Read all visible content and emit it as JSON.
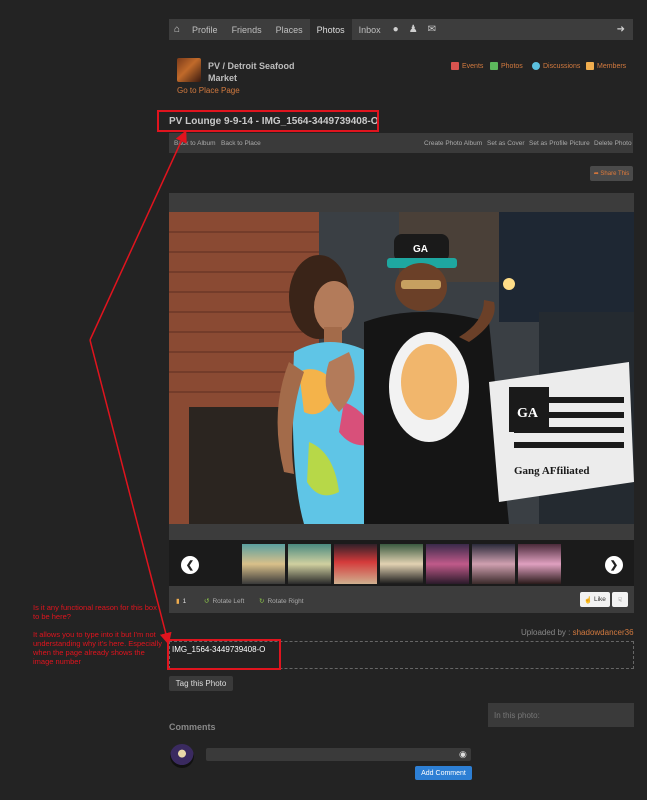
{
  "nav": {
    "items": [
      "Profile",
      "Friends",
      "Places",
      "Photos",
      "Inbox"
    ],
    "active": "Photos"
  },
  "place": {
    "name": "PV / Detroit Seafood Market",
    "goto_link": "Go to Place Page",
    "links": [
      {
        "label": "Events",
        "icon": "calendar-icon",
        "color": "#d9534f"
      },
      {
        "label": "Photos",
        "icon": "photo-icon",
        "color": "#5cb85c"
      },
      {
        "label": "Discussions",
        "icon": "chat-icon",
        "color": "#5bc0de"
      },
      {
        "label": "Members",
        "icon": "members-icon",
        "color": "#f0ad4e"
      }
    ]
  },
  "album": {
    "title": "PV Lounge 9-9-14 - IMG_1564-3449739408-O"
  },
  "toolbar": {
    "back_to_album": "Back to Album",
    "back_to_place": "Back to Place",
    "create_album": "Create Photo Album",
    "set_cover": "Set as Cover",
    "set_profile": "Set as Profile Picture",
    "delete": "Delete Photo"
  },
  "share_label": "Share This",
  "actions": {
    "count": "1",
    "rotate_left": "Rotate Left",
    "rotate_right": "Rotate Right",
    "like": "Like"
  },
  "uploaded": {
    "prefix": "Uploaded by :",
    "user": "shadowdancer36"
  },
  "caption": "IMG_1564-3449739408-O",
  "tag_label": "Tag this Photo",
  "in_photo_label": "In this photo:",
  "comments": {
    "header": "Comments",
    "add_label": "Add Comment"
  },
  "photo": {
    "hat_text": "GA",
    "laptop_text": "Gang AFfiliated"
  },
  "annotation": {
    "p1": "Is it any functional reason for this box to be here?",
    "p2": "It allows you to type into it but I'm not understanding why it's here. Especially when the page already shows the image number"
  },
  "colors": {
    "accent": "#d37a3f",
    "annotation": "#e0141e",
    "button_blue": "#2d7fd4"
  }
}
